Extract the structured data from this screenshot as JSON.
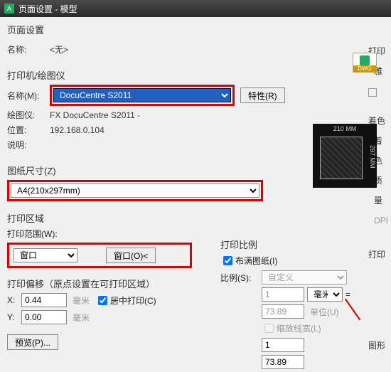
{
  "title": "页面设置 - 模型",
  "header": "页面设置",
  "name_label": "名称:",
  "name_value": "<无>",
  "dwg_badge": "DWG",
  "printer_section": "打印机/绘图仪",
  "printer_name_label": "名称(M):",
  "printer_selected": "DocuCentre S2011",
  "props_button": "特性(R)",
  "plotter_label": "绘图仪:",
  "plotter_value": "FX DocuCentre S2011 -",
  "location_label": "位置:",
  "location_value": "192.168.0.104",
  "desc_label": "说明:",
  "preview_dim": "210 MM",
  "preview_dim2": "297 MM",
  "papersize_section": "图纸尺寸(Z)",
  "papersize_value": "A4(210x297mm)",
  "printarea_section": "打印区域",
  "printrange_label": "打印范围(W):",
  "printrange_value": "窗口",
  "window_button": "窗口(O)<",
  "offset_section": "打印偏移（原点设置在可打印区域）",
  "x_label": "X:",
  "x_value": "0.44",
  "y_label": "Y:",
  "y_value": "0.00",
  "unit_mm": "毫米",
  "center_print": "居中打印(C)",
  "preview_button": "预览(P)...",
  "scale_section": "打印比例",
  "fit_to_paper": "布满图纸(I)",
  "scale_ratio_label": "比例(S):",
  "scale_ratio_value": "自定义",
  "scale_num": "1",
  "scale_unit": "毫米",
  "scale_eq": "=",
  "scale_denom": "73.89",
  "scale_unit_label": "单位(U)",
  "scale_lineweight": "缩放线宽(L)",
  "scale_num2": "1",
  "scale_denom2": "73.89",
  "side": {
    "print": "打印",
    "ya": "雅",
    "shade": "着色",
    "shade2": "着色",
    "quality": "质量",
    "dpi": "DPI",
    "printopt": "打印",
    "graphics": "图形"
  }
}
